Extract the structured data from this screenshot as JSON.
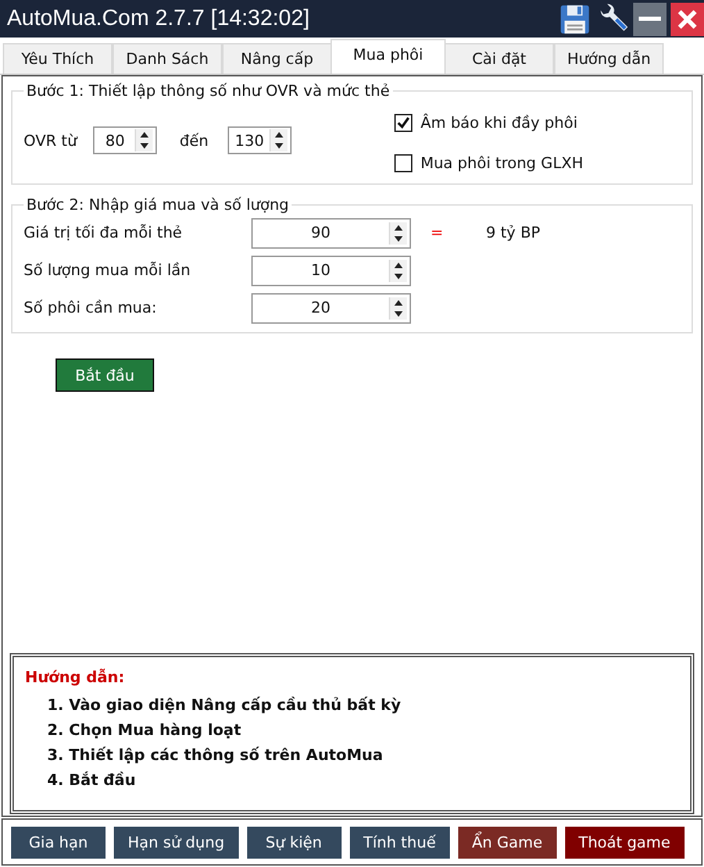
{
  "window": {
    "title": "AutoMua.Com 2.7.7 [14:32:02]"
  },
  "tabs": [
    {
      "label": "Yêu Thích",
      "selected": false
    },
    {
      "label": "Danh Sách",
      "selected": false
    },
    {
      "label": "Nâng cấp",
      "selected": false
    },
    {
      "label": "Mua phôi",
      "selected": true
    },
    {
      "label": "Cài đặt",
      "selected": false
    },
    {
      "label": "Hướng dẫn",
      "selected": false
    }
  ],
  "step1": {
    "title": "Bước 1: Thiết lập thông số như OVR và mức thẻ",
    "ovr_label": "OVR từ",
    "ovr_from": "80",
    "to_label": "đến",
    "ovr_to": "130",
    "options": [
      {
        "label": "Âm báo khi đầy phôi",
        "checked": true
      },
      {
        "label": "Mua phôi trong GLXH",
        "checked": false
      }
    ]
  },
  "step2": {
    "title": "Bước 2: Nhập giá mua và số lượng",
    "rows": [
      {
        "label": "Giá trị tối đa mỗi thẻ",
        "value": "90",
        "equals": "=",
        "result": "9 tỷ BP"
      },
      {
        "label": "Số lượng mua mỗi lần",
        "value": "10"
      },
      {
        "label": "Số phôi cần mua:",
        "value": "20"
      }
    ]
  },
  "start_button": "Bắt đầu",
  "guide": {
    "title": "Hướng dẫn:",
    "steps": [
      "1. Vào giao diện Nâng cấp cầu thủ bất kỳ",
      "2. Chọn Mua hàng loạt",
      "3. Thiết lập các thông số trên AutoMua",
      "4. Bắt đầu"
    ]
  },
  "footer_buttons": [
    {
      "label": "Gia hạn",
      "color": "#34495e"
    },
    {
      "label": "Hạn sử dụng",
      "color": "#34495e"
    },
    {
      "label": "Sự kiện",
      "color": "#34495e"
    },
    {
      "label": "Tính thuế",
      "color": "#34495e"
    },
    {
      "label": "Ẩn Game",
      "color": "#7b2a24"
    },
    {
      "label": "Thoát game",
      "color": "#800000"
    }
  ]
}
